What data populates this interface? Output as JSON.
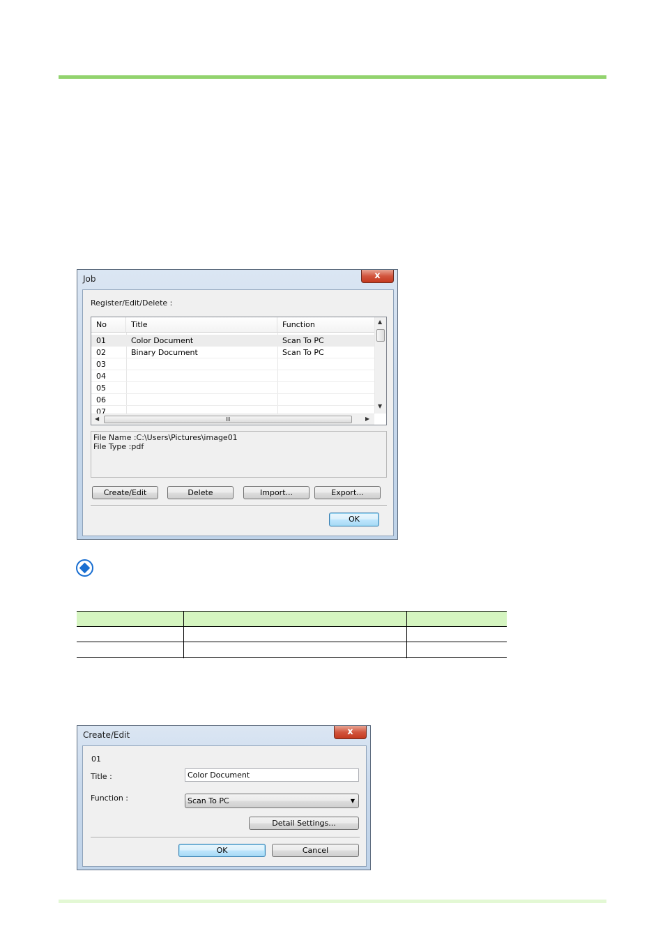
{
  "job_dialog": {
    "title": "Job",
    "close_glyph": "x",
    "section_label": "Register/Edit/Delete :",
    "columns": [
      "No",
      "Title",
      "Function"
    ],
    "rows": [
      {
        "no": "01",
        "title": "Color Document",
        "function": "Scan To PC"
      },
      {
        "no": "02",
        "title": "Binary Document",
        "function": "Scan To PC"
      },
      {
        "no": "03",
        "title": "",
        "function": ""
      },
      {
        "no": "04",
        "title": "",
        "function": ""
      },
      {
        "no": "05",
        "title": "",
        "function": ""
      },
      {
        "no": "06",
        "title": "",
        "function": ""
      },
      {
        "no": "07",
        "title": "",
        "function": ""
      }
    ],
    "scroll_grip": "III",
    "info_file_name": "File Name :C:\\Users\\Pictures\\image01",
    "info_file_type": "File Type :pdf",
    "buttons": {
      "create_edit": "Create/Edit",
      "delete": "Delete",
      "import": "Import...",
      "export": "Export...",
      "ok": "OK"
    }
  },
  "create_edit_dialog": {
    "title": "Create/Edit",
    "close_glyph": "x",
    "number": "01",
    "title_label": "Title :",
    "title_value": "Color Document",
    "function_label": "Function :",
    "function_value": "Scan To PC",
    "detail_settings": "Detail Settings...",
    "ok": "OK",
    "cancel": "Cancel"
  },
  "colors": {
    "accent_green": "#92d36e",
    "table_header": "#d5f5c0",
    "note_icon": "#1a6fd1"
  }
}
